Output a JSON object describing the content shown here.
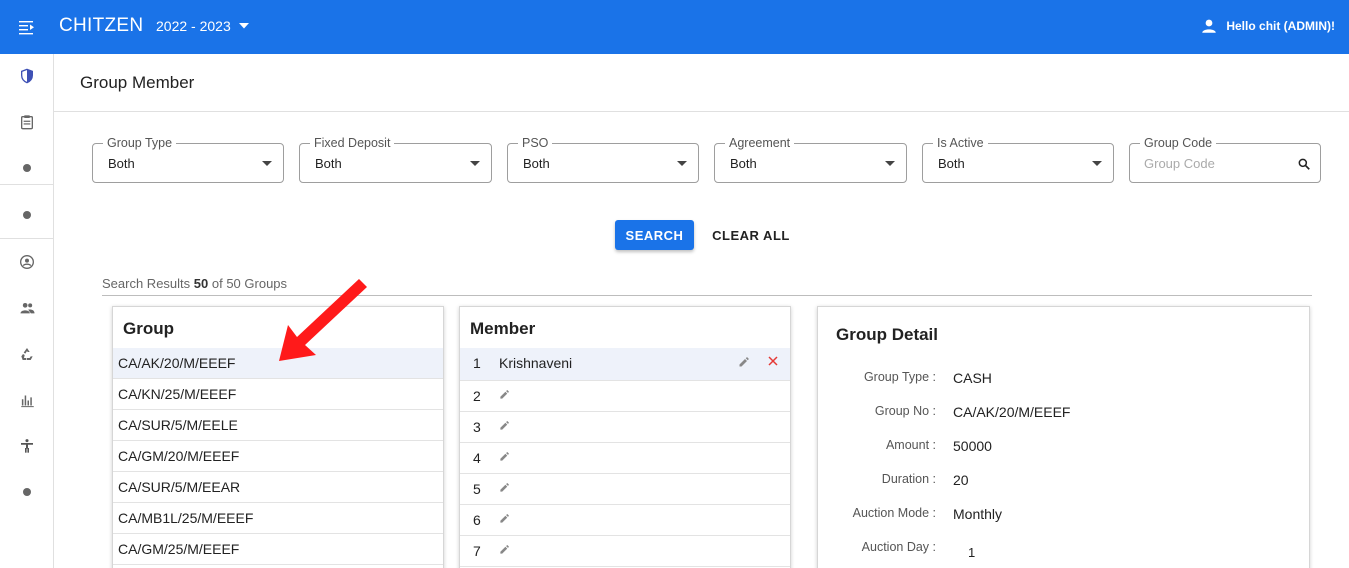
{
  "app": {
    "brand": "CHITZEN",
    "year_selector": "2022 - 2023",
    "user_greeting": "Hello chit (ADMIN)!"
  },
  "sidebar": {
    "items": [
      {
        "icon": "shield-icon"
      },
      {
        "icon": "clipboard-icon"
      },
      {
        "icon": "dot-icon"
      },
      {
        "icon": "dot-icon"
      },
      {
        "icon": "account-circle-icon"
      },
      {
        "icon": "people-icon"
      },
      {
        "icon": "recycle-icon"
      },
      {
        "icon": "bar-chart-icon"
      },
      {
        "icon": "accessibility-icon"
      },
      {
        "icon": "dot-icon"
      }
    ]
  },
  "page": {
    "title": "Group Member"
  },
  "filters": {
    "group_type": {
      "label": "Group Type",
      "value": "Both"
    },
    "fixed_deposit": {
      "label": "Fixed Deposit",
      "value": "Both"
    },
    "pso": {
      "label": "PSO",
      "value": "Both"
    },
    "agreement": {
      "label": "Agreement",
      "value": "Both"
    },
    "is_active": {
      "label": "Is Active",
      "value": "Both"
    },
    "group_code": {
      "label": "Group Code",
      "placeholder": "Group Code",
      "value": ""
    }
  },
  "actions": {
    "search": "SEARCH",
    "clear_all": "CLEAR ALL"
  },
  "results": {
    "prefix": "Search Results",
    "shown": "50",
    "middle": "of 50 Groups"
  },
  "group_panel": {
    "title": "Group",
    "rows": [
      "CA/AK/20/M/EEEF",
      "CA/KN/25/M/EEEF",
      "CA/SUR/5/M/EELE",
      "CA/GM/20/M/EEEF",
      "CA/SUR/5/M/EEAR",
      "CA/MB1L/25/M/EEEF",
      "CA/GM/25/M/EEEF"
    ],
    "selected_index": 0
  },
  "member_panel": {
    "title": "Member",
    "rows": [
      {
        "num": "1",
        "name": "Krishnaveni"
      },
      {
        "num": "2",
        "name": ""
      },
      {
        "num": "3",
        "name": ""
      },
      {
        "num": "4",
        "name": ""
      },
      {
        "num": "5",
        "name": ""
      },
      {
        "num": "6",
        "name": ""
      },
      {
        "num": "7",
        "name": ""
      }
    ]
  },
  "detail_panel": {
    "title": "Group Detail",
    "fields": [
      {
        "label": "Group Type :",
        "value": "CASH"
      },
      {
        "label": "Group No :",
        "value": "CA/AK/20/M/EEEF"
      },
      {
        "label": "Amount :",
        "value": "50000"
      },
      {
        "label": "Duration :",
        "value": "20"
      },
      {
        "label": "Auction Mode :",
        "value": "Monthly"
      },
      {
        "label": "Auction Day :",
        "value": "1"
      }
    ]
  },
  "colors": {
    "primary": "#1a73e8",
    "arrow": "#ff1a1a",
    "delete": "#e53935",
    "selected_row": "#eef2fa"
  }
}
